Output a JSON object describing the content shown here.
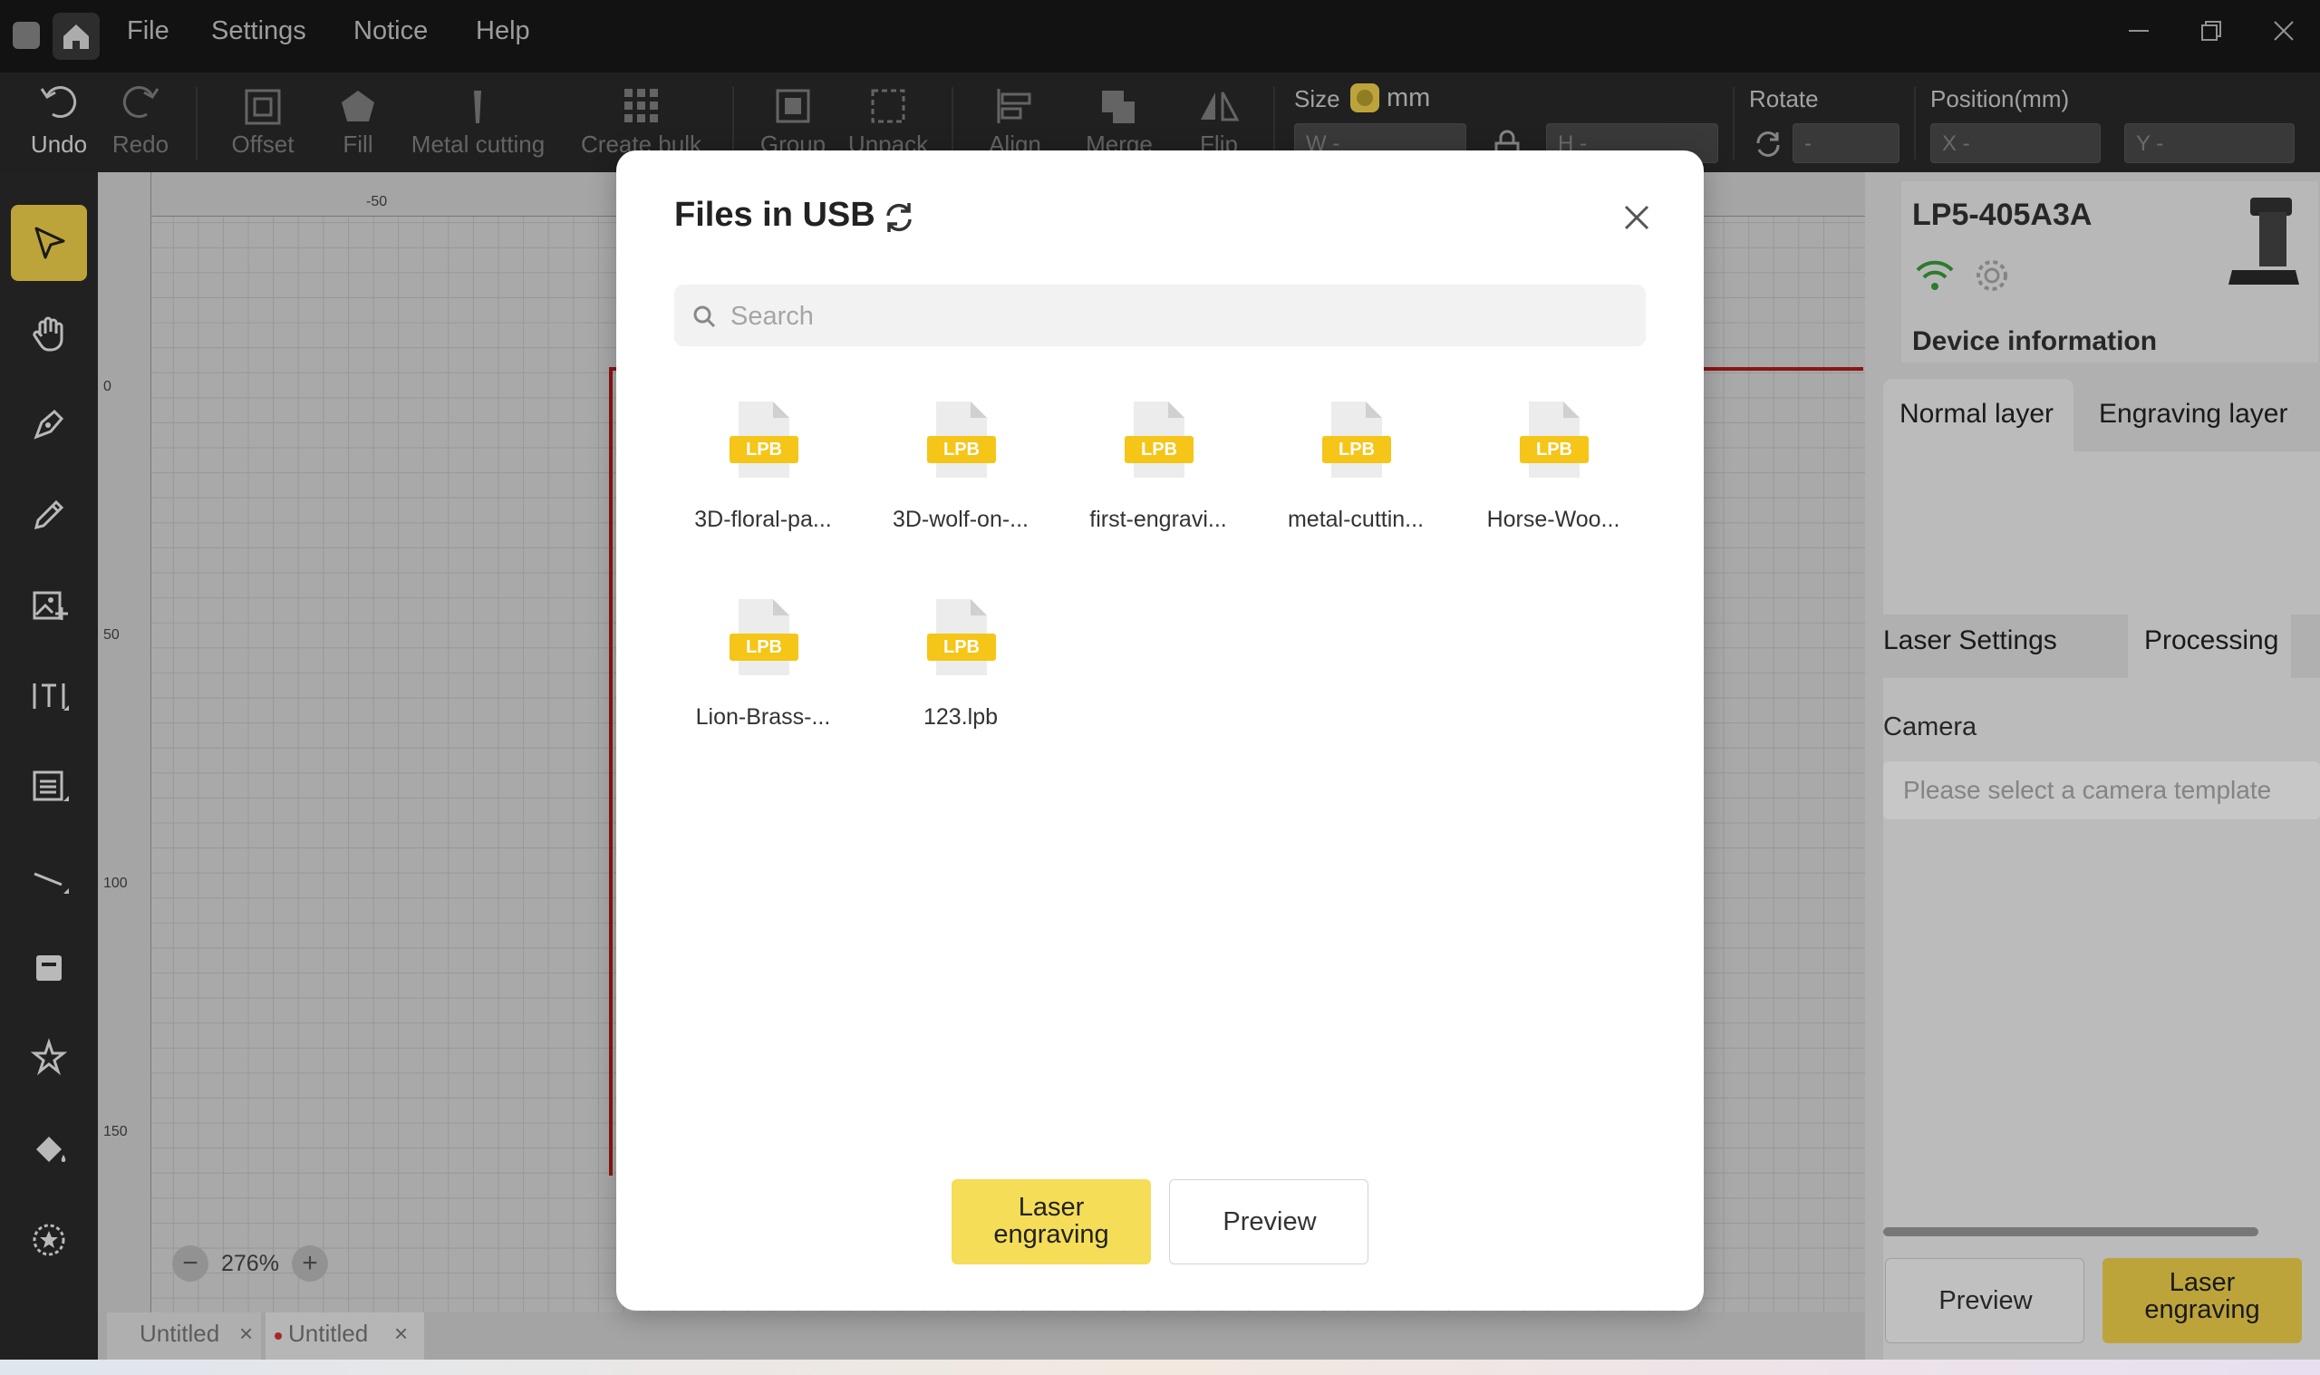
{
  "menu": {
    "file": "File",
    "settings": "Settings",
    "notice": "Notice",
    "help": "Help"
  },
  "toolbar": {
    "undo": "Undo",
    "redo": "Redo",
    "offset": "Offset",
    "fill": "Fill",
    "metal_cutting": "Metal cutting",
    "create_bulk": "Create bulk",
    "group": "Group",
    "unpack": "Unpack",
    "align": "Align",
    "merge": "Merge",
    "flip": "Flip",
    "size_label": "Size",
    "unit": "mm",
    "w_placeholder": "W -",
    "h_placeholder": "H -",
    "rotate_label": "Rotate",
    "rotate_placeholder": "-",
    "position_label": "Position(mm)",
    "x_placeholder": "X -",
    "y_placeholder": "Y -"
  },
  "ruler": {
    "top": [
      "-50"
    ],
    "left": [
      "0",
      "50",
      "100",
      "150"
    ]
  },
  "zoom": {
    "value": "276%",
    "minus": "−",
    "plus": "+"
  },
  "doc_tabs": [
    {
      "label": "Untitled",
      "close": "×"
    },
    {
      "label": "Untitled",
      "close": "×"
    }
  ],
  "right_panel": {
    "device_name": "LP5-405A3A",
    "device_info": "Device information",
    "layer_tabs": [
      "Normal layer",
      "Engraving layer"
    ],
    "settings_tabs": [
      "Laser Settings",
      "Processing"
    ],
    "camera_label": "Camera",
    "camera_placeholder": "Please select a camera template",
    "preview": "Preview",
    "laser_engraving": "Laser engraving"
  },
  "modal": {
    "title": "Files in USB",
    "search_placeholder": "Search",
    "file_badge": "LPB",
    "files": [
      "3D-floral-pa...",
      "3D-wolf-on-...",
      "first-engravi...",
      "metal-cuttin...",
      "Horse-Woo...",
      "Lion-Brass-...",
      "123.lpb"
    ],
    "laser_engraving": "Laser engraving",
    "preview": "Preview"
  },
  "colors": {
    "accent": "#f1d34c",
    "file_icon": "#f5c518",
    "wifi": "#3a9d3a",
    "doc_dot": "#d9322e"
  }
}
